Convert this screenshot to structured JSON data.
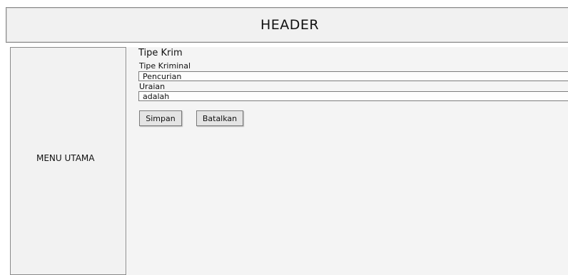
{
  "header": {
    "title": "HEADER"
  },
  "sidebar": {
    "label": "MENU UTAMA"
  },
  "main": {
    "title": "Tipe Krim",
    "fields": [
      {
        "label": "Tipe Kriminal",
        "value": "Pencurian"
      },
      {
        "label": "Uraian",
        "value": "adalah"
      }
    ],
    "buttons": {
      "save": "Simpan",
      "cancel": "Batalkan"
    }
  }
}
